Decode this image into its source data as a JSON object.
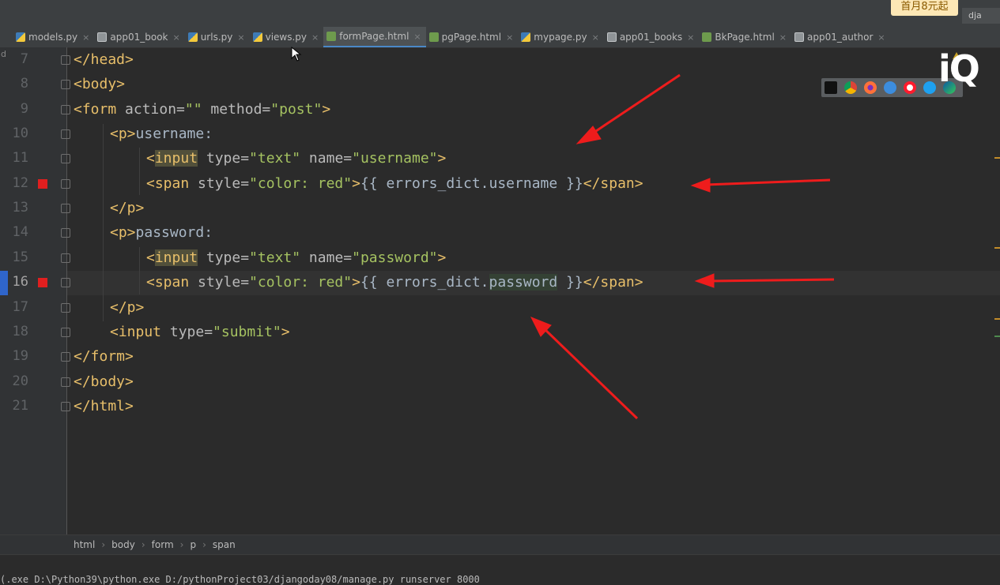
{
  "promo": "首月8元起",
  "topright": "dja",
  "tabs": [
    {
      "label": "models.py",
      "icon": "python-file-icon",
      "kind": "py"
    },
    {
      "label": "app01_book",
      "icon": "table-icon",
      "kind": "db"
    },
    {
      "label": "urls.py",
      "icon": "python-file-icon",
      "kind": "py"
    },
    {
      "label": "views.py",
      "icon": "python-file-icon",
      "kind": "py"
    },
    {
      "label": "formPage.html",
      "icon": "html-file-icon",
      "kind": "html",
      "active": true
    },
    {
      "label": "pgPage.html",
      "icon": "html-file-icon",
      "kind": "html"
    },
    {
      "label": "mypage.py",
      "icon": "python-file-icon",
      "kind": "py"
    },
    {
      "label": "app01_books",
      "icon": "table-icon",
      "kind": "db"
    },
    {
      "label": "BkPage.html",
      "icon": "html-file-icon",
      "kind": "html"
    },
    {
      "label": "app01_author",
      "icon": "table-icon",
      "kind": "db"
    }
  ],
  "gutter_letter": "d",
  "watermark": "iQ",
  "code_lines": [
    {
      "num": "7",
      "indent": 0,
      "tokens": [
        [
          "tag",
          "</head>"
        ]
      ]
    },
    {
      "num": "8",
      "indent": 0,
      "tokens": [
        [
          "tag",
          "<body>"
        ]
      ]
    },
    {
      "num": "9",
      "indent": 0,
      "tokens": [
        [
          "tag",
          "<form "
        ],
        [
          "attr",
          "action="
        ],
        [
          "val",
          "\"\""
        ],
        [
          "attr",
          " method="
        ],
        [
          "val",
          "\"post\""
        ],
        [
          "tag",
          ">"
        ]
      ]
    },
    {
      "num": "10",
      "indent": 1,
      "tokens": [
        [
          "tag",
          "<p>"
        ],
        [
          "txt",
          "username:"
        ]
      ]
    },
    {
      "num": "11",
      "indent": 2,
      "tokens": [
        [
          "tag",
          "<"
        ],
        [
          "taghl",
          "input"
        ],
        [
          "attr",
          " type="
        ],
        [
          "val",
          "\"text\""
        ],
        [
          "attr",
          " name="
        ],
        [
          "val",
          "\"username\""
        ],
        [
          "tag",
          ">"
        ]
      ]
    },
    {
      "num": "12",
      "indent": 2,
      "breakpoint": true,
      "tokens": [
        [
          "tag",
          "<span "
        ],
        [
          "attr",
          "style="
        ],
        [
          "val",
          "\"color: red\""
        ],
        [
          "tag",
          ">"
        ],
        [
          "txt",
          "{{ errors_dict.username }}"
        ],
        [
          "tag",
          "</span>"
        ]
      ]
    },
    {
      "num": "13",
      "indent": 1,
      "tokens": [
        [
          "tag",
          "</p>"
        ]
      ]
    },
    {
      "num": "14",
      "indent": 1,
      "tokens": [
        [
          "tag",
          "<p>"
        ],
        [
          "txt",
          "password:"
        ]
      ]
    },
    {
      "num": "15",
      "indent": 2,
      "tokens": [
        [
          "tag",
          "<"
        ],
        [
          "taghl",
          "input"
        ],
        [
          "attr",
          " type="
        ],
        [
          "val",
          "\"text\""
        ],
        [
          "attr",
          " name="
        ],
        [
          "val",
          "\"password\""
        ],
        [
          "tag",
          ">"
        ]
      ]
    },
    {
      "num": "16",
      "indent": 2,
      "breakpoint": true,
      "current": true,
      "tokens": [
        [
          "tag",
          "<span "
        ],
        [
          "attr",
          "style="
        ],
        [
          "val",
          "\"color: red\""
        ],
        [
          "tag",
          ">"
        ],
        [
          "txt",
          "{{ errors_dict."
        ],
        [
          "txthl",
          "password"
        ],
        [
          "txt",
          " }}"
        ],
        [
          "tag",
          "</span>"
        ]
      ]
    },
    {
      "num": "17",
      "indent": 1,
      "tokens": [
        [
          "tag",
          "</p>"
        ]
      ]
    },
    {
      "num": "18",
      "indent": 1,
      "tokens": [
        [
          "tag",
          "<input "
        ],
        [
          "attr",
          "type="
        ],
        [
          "val",
          "\"submit\""
        ],
        [
          "tag",
          ">"
        ]
      ]
    },
    {
      "num": "19",
      "indent": 0,
      "tokens": [
        [
          "tag",
          "</form>"
        ]
      ]
    },
    {
      "num": "20",
      "indent": 0,
      "tokens": [
        [
          "tag",
          "</body>"
        ]
      ]
    },
    {
      "num": "21",
      "indent": 0,
      "tokens": [
        [
          "tag",
          "</html>"
        ]
      ]
    }
  ],
  "breadcrumb": [
    "html",
    "body",
    "form",
    "p",
    "span"
  ],
  "terminal_text": "(.exe D:\\Python39\\python.exe D:/pythonProject03/djangoday08/manage.py runserver 8000",
  "colors": {
    "accent": "#4a88c7",
    "breakpoint": "#e01f1f",
    "arrow": "#ee1c1c"
  }
}
